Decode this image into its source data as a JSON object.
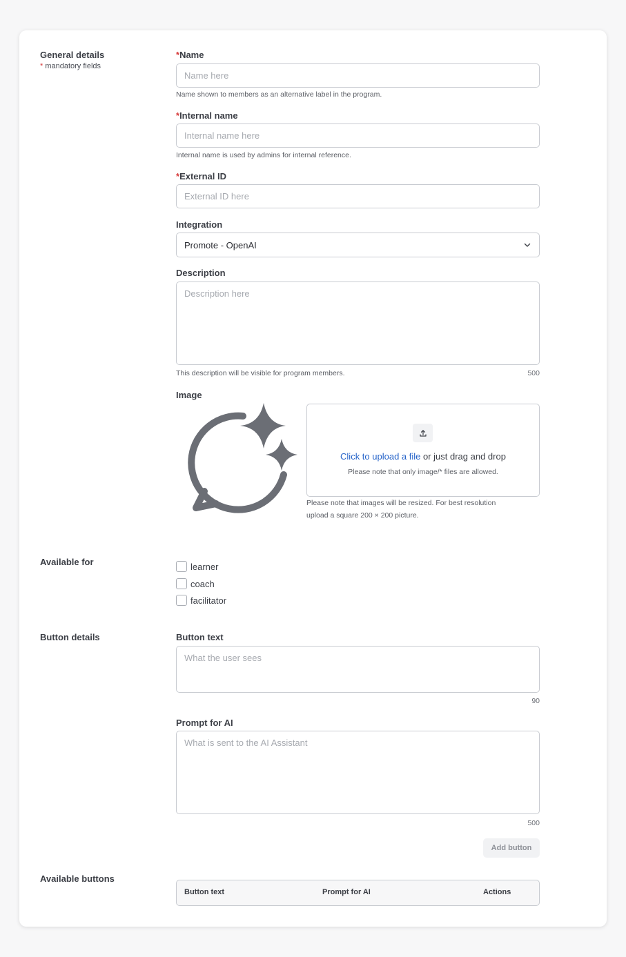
{
  "general": {
    "title": "General details",
    "mandatory_star": "*",
    "mandatory_text": " mandatory fields"
  },
  "fields": {
    "required_star": "*",
    "name": {
      "label": "Name",
      "placeholder": "Name here",
      "value": "",
      "hint": "Name shown to members as an alternative label in the program."
    },
    "internal_name": {
      "label": "Internal name",
      "placeholder": "Internal name here",
      "value": "",
      "hint": "Internal name is used by admins for internal reference."
    },
    "external_id": {
      "label": "External ID",
      "placeholder": "External ID here",
      "value": ""
    },
    "integration": {
      "label": "Integration",
      "selected": "Promote - OpenAI",
      "icon": "chevron-down-icon"
    },
    "description": {
      "label": "Description",
      "placeholder": "Description here",
      "value": "",
      "hint": "This description will be visible for program members.",
      "counter": "500"
    },
    "image": {
      "label": "Image",
      "preview_icon": "chat-sparkle-icon",
      "upload_icon": "upload-icon",
      "upload_link": "Click to upload a file",
      "upload_rest": " or just drag and drop",
      "upload_note": "Please note that only image/* files are allowed.",
      "resize_note_line1": "Please note that images will be resized. For best resolution",
      "resize_note_line2": "upload a square 200 × 200 picture."
    }
  },
  "available_for": {
    "title": "Available for",
    "options": [
      {
        "label": "learner",
        "checked": false
      },
      {
        "label": "coach",
        "checked": false
      },
      {
        "label": "facilitator",
        "checked": false
      }
    ]
  },
  "button_details": {
    "title": "Button details",
    "button_text": {
      "label": "Button text",
      "placeholder": "What the user sees",
      "value": "",
      "counter": "90"
    },
    "prompt": {
      "label": "Prompt for AI",
      "placeholder": "What is sent to the AI Assistant",
      "value": "",
      "counter": "500"
    },
    "add_button_label": "Add button"
  },
  "available_buttons": {
    "title": "Available buttons",
    "columns": [
      "Button text",
      "Prompt for AI",
      "Actions"
    ],
    "rows": []
  },
  "colors": {
    "accent_link": "#2563c9",
    "required_star": "#d63a3a",
    "icon_gray": "#6b6e75"
  }
}
